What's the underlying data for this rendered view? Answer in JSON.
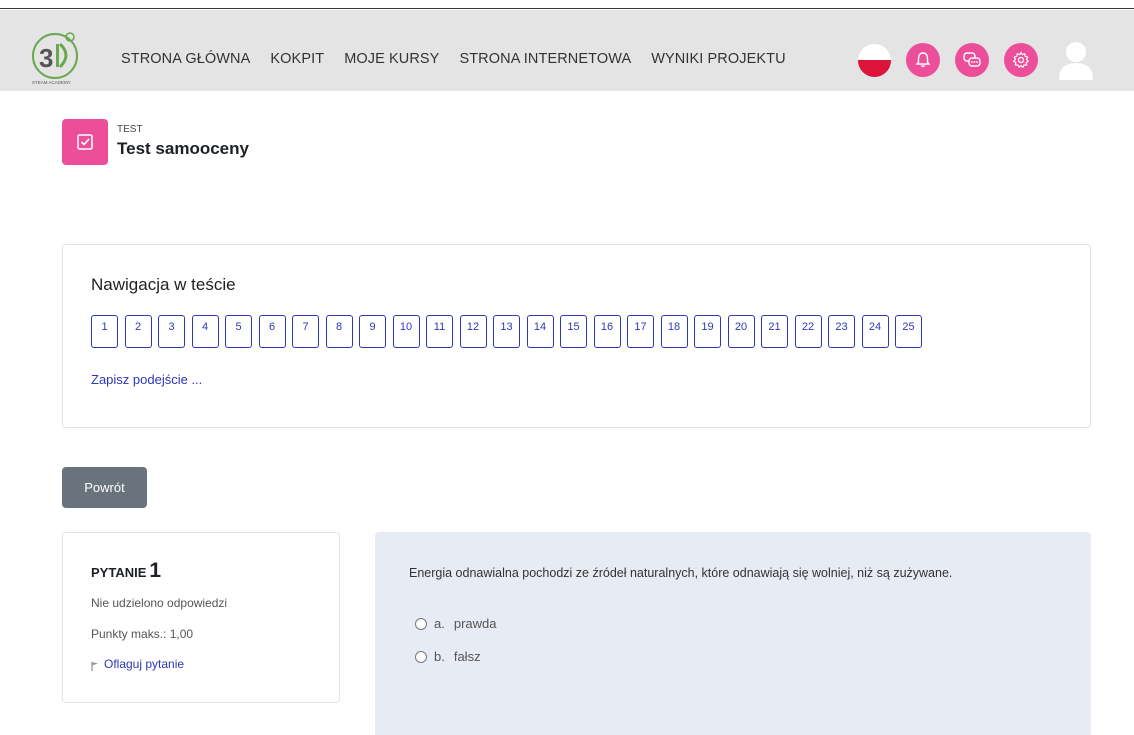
{
  "nav": {
    "links": [
      "STRONA GŁÓWNA",
      "KOKPIT",
      "MOJE KURSY",
      "STRONA INTERNETOWA",
      "WYNIKI PROJEKTU"
    ],
    "icons": [
      "flag-poland-icon",
      "notification-bell-icon",
      "messages-icon",
      "settings-gear-icon",
      "user-avatar-icon"
    ],
    "accent": "#ec4e99",
    "navbar_bg": "#e4e4e4"
  },
  "header": {
    "kicker": "TEST",
    "title": "Test samooceny"
  },
  "quiz_nav": {
    "title": "Nawigacja w teście",
    "questions": [
      "1",
      "2",
      "3",
      "4",
      "5",
      "6",
      "7",
      "8",
      "9",
      "10",
      "11",
      "12",
      "13",
      "14",
      "15",
      "16",
      "17",
      "18",
      "19",
      "20",
      "21",
      "22",
      "23",
      "24",
      "25"
    ],
    "save_link": "Zapisz podejście ..."
  },
  "back_button": "Powrót",
  "question_info": {
    "label": "PYTANIE",
    "number": "1",
    "state": "Nie udzielono odpowiedzi",
    "marks": "Punkty maks.: 1,00",
    "flag_link": "Oflaguj pytanie"
  },
  "question": {
    "text": "Energia odnawialna pochodzi ze źródeł naturalnych, które odnawiają się wolniej, niż są zużywane.",
    "answers": [
      {
        "letter": "a.",
        "label": "prawda"
      },
      {
        "letter": "b.",
        "label": "fałsz"
      }
    ]
  },
  "colors": {
    "link": "#2b38b8",
    "question_bg": "#e7ebf4",
    "back_button_bg": "#6a737b"
  }
}
